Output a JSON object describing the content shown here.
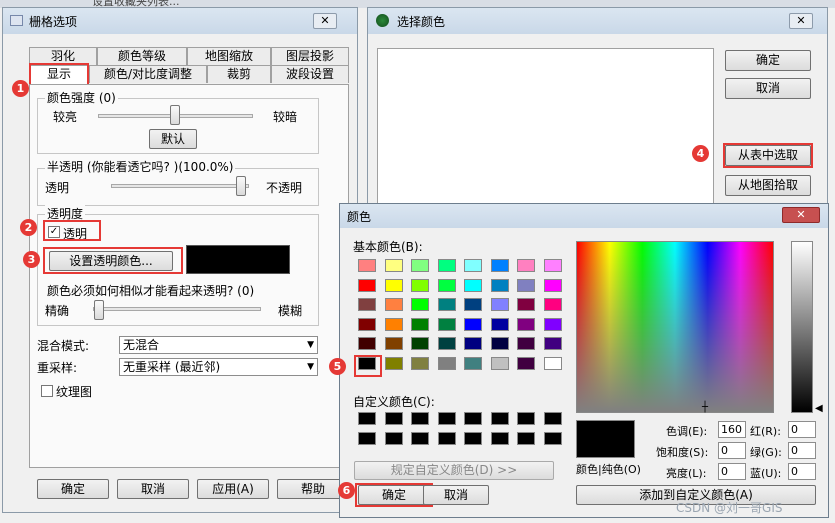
{
  "raster_dialog": {
    "title": "栅格选项",
    "close": "✕",
    "tabs_row1": [
      "羽化",
      "颜色等级",
      "地图缩放",
      "图层投影"
    ],
    "tabs_row2": [
      "显示",
      "颜色/对比度调整",
      "裁剪",
      "波段设置"
    ],
    "brightness": {
      "title": "颜色强度 (0)",
      "left": "较亮",
      "right": "较暗",
      "default_btn": "默认"
    },
    "translucent": {
      "title": "半透明 (你能看透它吗? )(100.0%)",
      "left": "透明",
      "right": "不透明"
    },
    "transparency": {
      "title": "透明度",
      "checkbox": "透明",
      "checked": true,
      "set_color_btn": "设置透明颜色...",
      "swatch_color": "#000000",
      "similarity": "颜色必须如何相似才能看起来透明? (0)",
      "left": "精确",
      "right": "模糊"
    },
    "blend": {
      "label": "混合模式:",
      "value": "无混合"
    },
    "resample": {
      "label": "重采样:",
      "value": "无重采样 (最近邻)"
    },
    "texture": {
      "label": "纹理图",
      "checked": false
    },
    "buttons": {
      "ok": "确定",
      "cancel": "取消",
      "apply": "应用(A)",
      "help": "帮助"
    }
  },
  "select_color_dialog": {
    "title": "选择颜色",
    "close": "✕",
    "ok": "确定",
    "cancel": "取消",
    "from_table": "从表中选取",
    "from_map": "从地图拾取"
  },
  "color_dialog": {
    "title": "颜色",
    "close": "✕",
    "basic_colors_label": "基本颜色(B):",
    "basic_colors": [
      [
        "#ff8080",
        "#ffff80",
        "#80ff80",
        "#00ff80",
        "#80ffff",
        "#0080ff",
        "#ff80c0",
        "#ff80ff"
      ],
      [
        "#ff0000",
        "#ffff00",
        "#80ff00",
        "#00ff40",
        "#00ffff",
        "#0080c0",
        "#8080c0",
        "#ff00ff"
      ],
      [
        "#804040",
        "#ff8040",
        "#00ff00",
        "#008080",
        "#004080",
        "#8080ff",
        "#800040",
        "#ff0080"
      ],
      [
        "#800000",
        "#ff8000",
        "#008000",
        "#008040",
        "#0000ff",
        "#0000a0",
        "#800080",
        "#8000ff"
      ],
      [
        "#400000",
        "#804000",
        "#004000",
        "#004040",
        "#000080",
        "#000040",
        "#400040",
        "#400080"
      ],
      [
        "#000000",
        "#808000",
        "#808040",
        "#808080",
        "#408080",
        "#c0c0c0",
        "#400040",
        "#ffffff"
      ]
    ],
    "custom_colors_label": "自定义颜色(C):",
    "define_custom_btn": "规定自定义颜色(D) >>",
    "color_solid_label": "颜色|纯色(O)",
    "hue_label": "色调(E):",
    "hue": "160",
    "sat_label": "饱和度(S):",
    "sat": "0",
    "lum_label": "亮度(L):",
    "lum": "0",
    "red_label": "红(R):",
    "red": "0",
    "green_label": "绿(G):",
    "green": "0",
    "blue_label": "蓝(U):",
    "blue": "0",
    "add_custom_btn": "添加到自定义颜色(A)",
    "ok": "确定",
    "cancel": "取消"
  },
  "badges": [
    "1",
    "2",
    "3",
    "4",
    "5",
    "6"
  ],
  "top_strip": {
    "partial_title": "设置收藏夹列表..."
  },
  "watermark": "CSDN @刘一哥GIS"
}
